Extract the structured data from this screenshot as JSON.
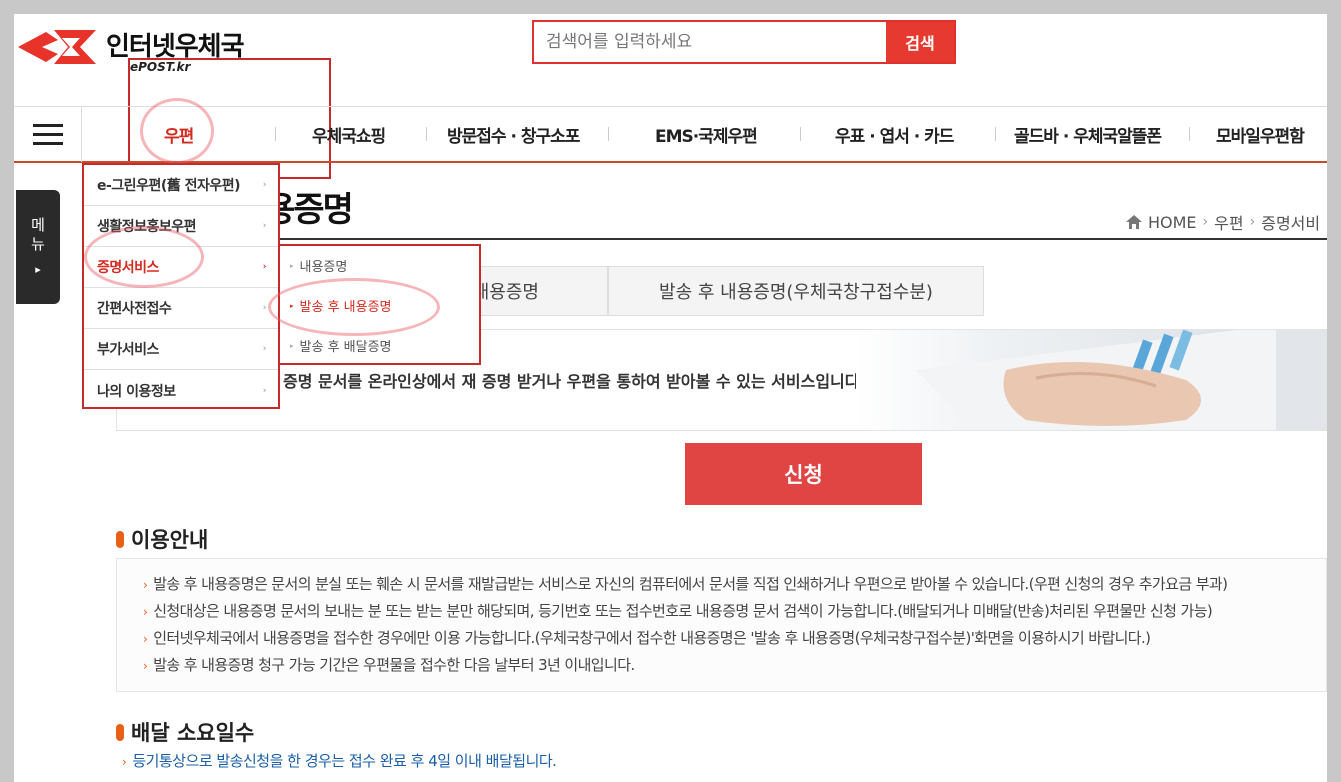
{
  "header": {
    "brand": "인터넷우체국",
    "brand_sub": "ePOST.kr",
    "search_placeholder": "검색어를 입력하세요",
    "search_button": "검색"
  },
  "gnb": {
    "menu_icon": "hamburger-icon",
    "items": [
      "우편",
      "우체국쇼핑",
      "방문접수 · 창구소포",
      "EMS·국제우편",
      "우표 · 엽서 · 카드",
      "골드바 · 우체국알뜰폰",
      "모바일우편함"
    ]
  },
  "side_tab": {
    "line1": "메",
    "line2": "뉴",
    "arrow": "▸"
  },
  "dropdown": {
    "items": [
      "e-그린우편(舊 전자우편)",
      "생활정보홍보우편",
      "증명서비스",
      "간편사전접수",
      "부가서비스",
      "나의 이용정보"
    ],
    "active": "증명서비스",
    "arrow": "›",
    "submenu": [
      "내용증명",
      "발송 후 내용증명",
      "발송 후 배달증명"
    ],
    "submenu_active": "발송 후 내용증명"
  },
  "page": {
    "title": "용증명",
    "breadcrumb": [
      "HOME",
      "우편",
      "증명서비"
    ],
    "tabs": [
      "내용증명",
      "발송 후 내용증명(우체국창구접수분)"
    ],
    "banner_text": "증명 문서를 온라인상에서 재 증명 받거나 우편을 통하여 받아볼 수 있는 서비스입니다.",
    "apply_button": "신청"
  },
  "guide": {
    "heading": "이용안내",
    "items": [
      "발송 후 내용증명은 문서의 분실 또는 훼손 시 문서를 재발급받는 서비스로 자신의 컴퓨터에서 문서를 직접 인쇄하거나 우편으로 받아볼 수 있습니다.(우편 신청의 경우 추가요금 부과)",
      "신청대상은 내용증명 문서의 보내는 분 또는 받는 분만 해당되며, 등기번호 또는 접수번호로 내용증명 문서 검색이 가능합니다.(배달되거나 미배달(반송)처리된 우편물만 신청 가능)",
      "인터넷우체국에서 내용증명을 접수한 경우에만 이용 가능합니다.(우체국창구에서 접수한 내용증명은 '발송 후 내용증명(우체국창구접수분)'화면을 이용하시기 바랍니다.)",
      "발송 후 내용증명 청구 가능 기간은 우편물을 접수한 다음 날부터 3년 이내입니다."
    ]
  },
  "delivery": {
    "heading": "배달 소요일수",
    "text": "등기통상으로 발송신청을 한 경우는 접수 완료 후 4일 이내 배달됩니다."
  },
  "colors": {
    "accent": "#e6392f",
    "bullet": "#e86018",
    "link": "#1a5fa8"
  }
}
